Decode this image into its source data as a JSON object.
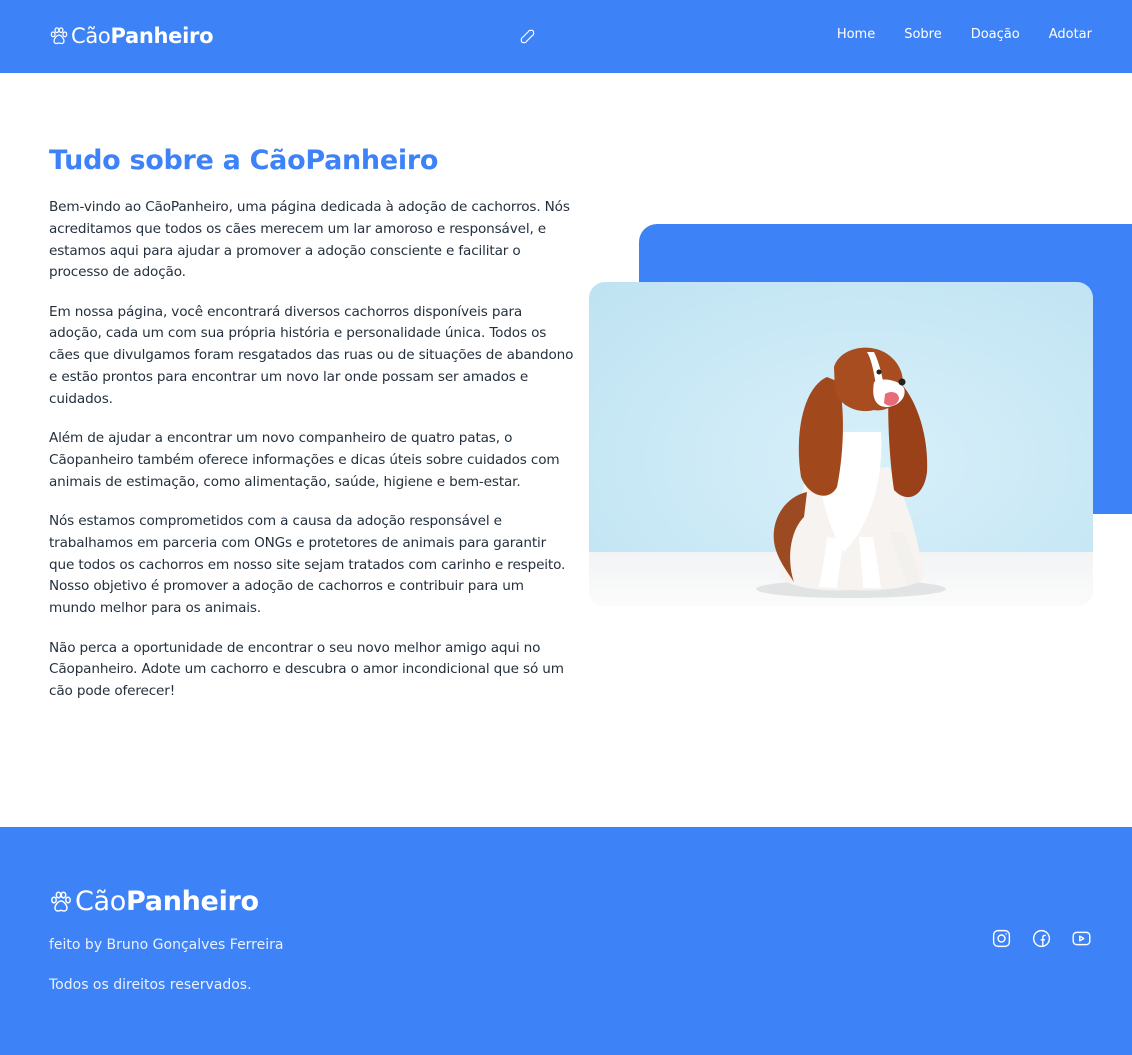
{
  "header": {
    "logo_light": "Cão",
    "logo_bold": "Panheiro",
    "nav": [
      {
        "label": "Home"
      },
      {
        "label": "Sobre"
      },
      {
        "label": "Doação"
      },
      {
        "label": "Adotar"
      }
    ]
  },
  "main": {
    "title": "Tudo sobre a CãoPanheiro",
    "paragraphs": [
      "Bem-vindo ao CãoPanheiro, uma página dedicada à adoção de cachorros. Nós acreditamos que todos os cães merecem um lar amoroso e responsável, e estamos aqui para ajudar a promover a adoção consciente e facilitar o processo de adoção.",
      "Em nossa página, você encontrará diversos cachorros disponíveis para adoção, cada um com sua própria história e personalidade única. Todos os cães que divulgamos foram resgatados das ruas ou de situações de abandono e estão prontos para encontrar um novo lar onde possam ser amados e cuidados.",
      "Além de ajudar a encontrar um novo companheiro de quatro patas, o Cãopanheiro também oferece informações e dicas úteis sobre cuidados com animais de estimação, como alimentação, saúde, higiene e bem-estar.",
      "Nós estamos comprometidos com a causa da adoção responsável e trabalhamos em parceria com ONGs e protetores de animais para garantir que todos os cachorros em nosso site sejam tratados com carinho e respeito. Nosso objetivo é promover a adoção de cachorros e contribuir para um mundo melhor para os animais.",
      "Não perca a oportunidade de encontrar o seu novo melhor amigo aqui no Cãopanheiro. Adote um cachorro e descubra o amor incondicional que só um cão pode oferecer!"
    ]
  },
  "footer": {
    "logo_light": "Cão",
    "logo_bold": "Panheiro",
    "credits": "feito by Bruno Gonçalves Ferreira",
    "rights": "Todos os direitos reservados.",
    "social": [
      "instagram-icon",
      "facebook-icon",
      "youtube-icon"
    ]
  },
  "colors": {
    "brand": "#3d82f6",
    "text": "#24303d",
    "photo_bg": "#c4e6f3"
  }
}
